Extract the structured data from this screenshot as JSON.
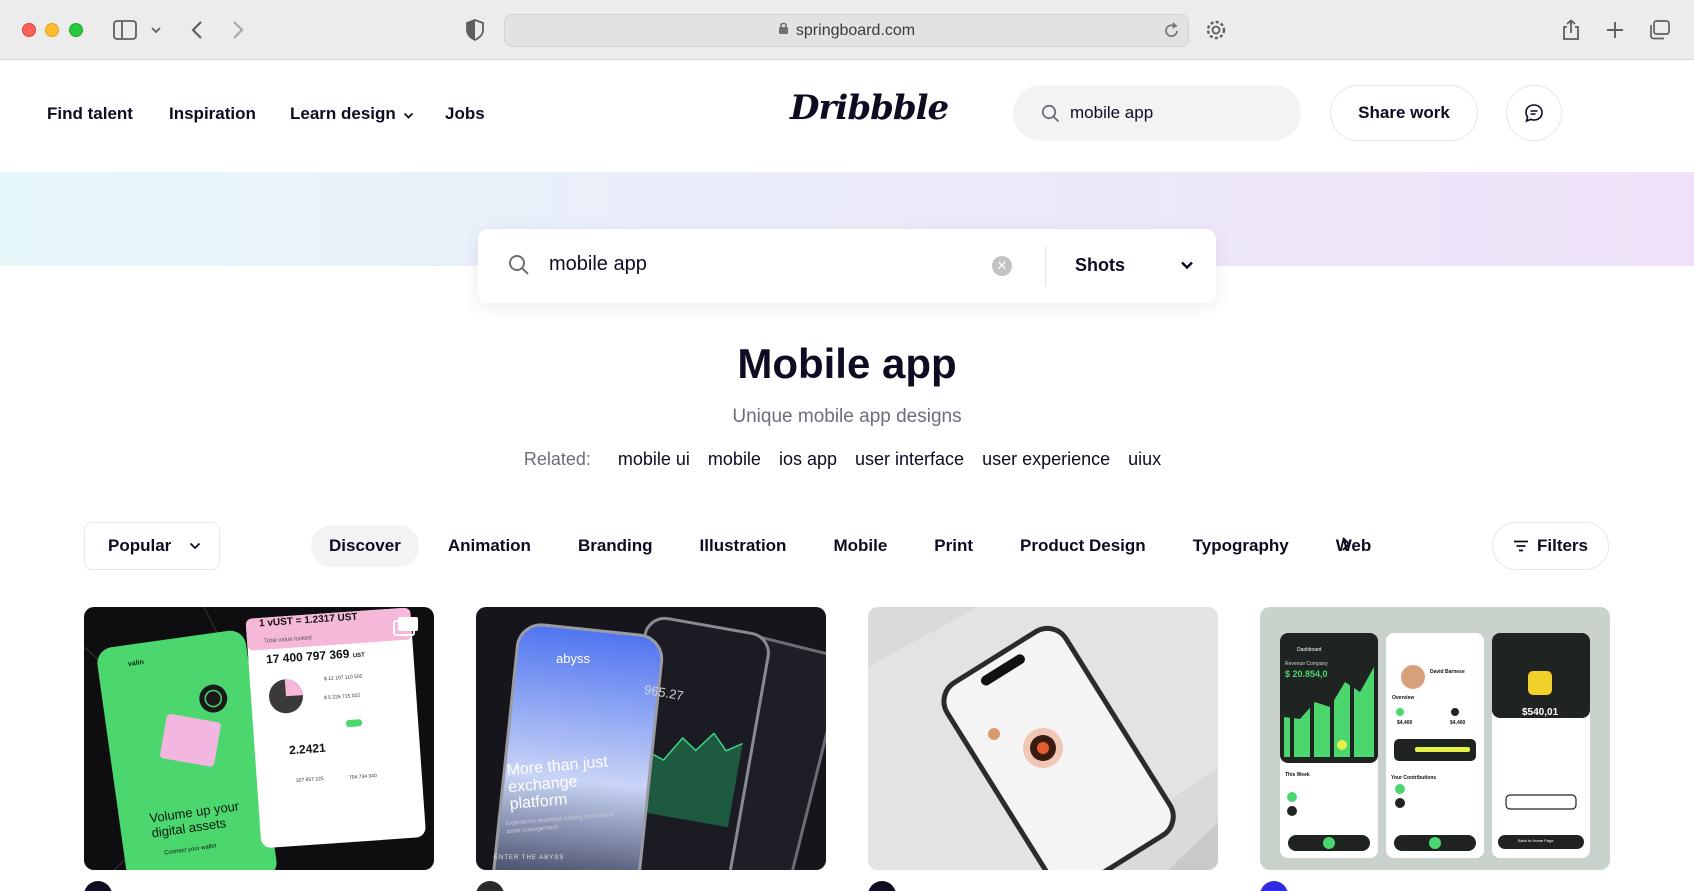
{
  "browser": {
    "url": "springboard.com"
  },
  "header": {
    "nav": [
      "Find talent",
      "Inspiration",
      "Learn design",
      "Jobs"
    ],
    "logo": "Dribbble",
    "search_value": "mobile app",
    "share_label": "Share work"
  },
  "search": {
    "query": "mobile app",
    "type": "Shots"
  },
  "page": {
    "title": "Mobile app",
    "subtitle": "Unique mobile app designs",
    "related_label": "Related:",
    "related": [
      "mobile ui",
      "mobile",
      "ios app",
      "user interface",
      "user experience",
      "uiux"
    ]
  },
  "filters": {
    "sort": "Popular",
    "categories": [
      "Discover",
      "Animation",
      "Branding",
      "Illustration",
      "Mobile",
      "Print",
      "Product Design",
      "Typography",
      "Web"
    ],
    "active_category": "Discover",
    "filters_label": "Filters"
  },
  "shots": [
    {
      "texts": [
        "1 vUST = 1.2317 UST",
        "Total value locked",
        "17 400 797 369",
        "UST",
        "$ 12 107 110 502",
        "$ 5 226 715 022",
        "2.2421",
        "327 857 225",
        "704 734 340",
        "valin",
        "Volume up your digital assets",
        "Connect your wallet"
      ]
    },
    {
      "texts": [
        "abyss",
        "965.27",
        "More than just exchange platform",
        "Experience seamless trading and secure asset management",
        "ENTER THE ABYSS"
      ]
    },
    {
      "texts": []
    },
    {
      "texts": [
        "Dashboard",
        "Revenue Company",
        "$ 20.854,0",
        "David Barnese",
        "Overview",
        "$4,400",
        "$4,400",
        "This Week",
        "Your Contributions",
        "$540,01",
        "Back to Home Page"
      ]
    }
  ],
  "colors": {
    "accent_green": "#4cd66e",
    "text_primary": "#0d0c22",
    "text_secondary": "#6e6d7a",
    "pill_bg": "#f3f3f4"
  }
}
